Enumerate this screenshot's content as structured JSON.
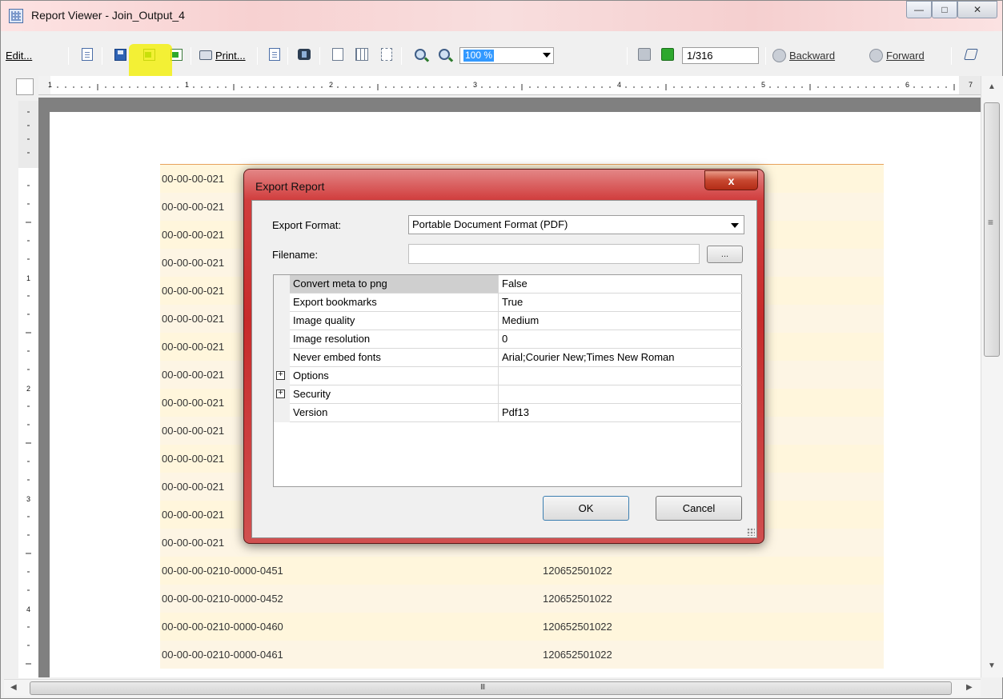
{
  "window": {
    "title": "Report Viewer - Join_Output_4",
    "controls": [
      "minimize",
      "maximize",
      "close"
    ]
  },
  "toolbar": {
    "edit_label": "Edit...",
    "print_label": "Print...",
    "zoom_value": "100 %",
    "page_value": "1/316",
    "backward_label": "Backward",
    "forward_label": "Forward",
    "icons": [
      "copy-icon",
      "save-icon",
      "export-icon",
      "export-page-icon",
      "print-icon",
      "copy-page-icon",
      "find-icon",
      "single-page-icon",
      "multi-page-icon",
      "continuous-icon",
      "zoom-out-icon",
      "zoom-in-icon",
      "prev-page-icon",
      "next-page-icon",
      "backward-icon",
      "forward-icon",
      "annotate-icon"
    ]
  },
  "ruler": {
    "horizontal_marks": [
      "1",
      "1",
      "2",
      "3",
      "4",
      "5",
      "6",
      "7"
    ],
    "vertical_marks": [
      "1",
      "2",
      "3",
      "4"
    ]
  },
  "report": {
    "rows": [
      {
        "id": "00-00-00-021",
        "value": ""
      },
      {
        "id": "00-00-00-021",
        "value": ""
      },
      {
        "id": "00-00-00-021",
        "value": ""
      },
      {
        "id": "00-00-00-021",
        "value": ""
      },
      {
        "id": "00-00-00-021",
        "value": ""
      },
      {
        "id": "00-00-00-021",
        "value": ""
      },
      {
        "id": "00-00-00-021",
        "value": ""
      },
      {
        "id": "00-00-00-021",
        "value": ""
      },
      {
        "id": "00-00-00-021",
        "value": ""
      },
      {
        "id": "00-00-00-021",
        "value": ""
      },
      {
        "id": "00-00-00-021",
        "value": ""
      },
      {
        "id": "00-00-00-021",
        "value": ""
      },
      {
        "id": "00-00-00-021",
        "value": ""
      },
      {
        "id": "00-00-00-021",
        "value": ""
      },
      {
        "id": "00-00-00-0210-0000-0451",
        "value": "120652501022"
      },
      {
        "id": "00-00-00-0210-0000-0452",
        "value": "120652501022"
      },
      {
        "id": "00-00-00-0210-0000-0460",
        "value": "120652501022"
      },
      {
        "id": "00-00-00-0210-0000-0461",
        "value": "120652501022"
      }
    ]
  },
  "dialog": {
    "title": "Export Report",
    "close_glyph": "x",
    "export_format_label": "Export Format:",
    "export_format_value": "Portable Document Format (PDF)",
    "filename_label": "Filename:",
    "filename_value": "",
    "browse_label": "...",
    "properties": [
      {
        "name": "Convert meta to png",
        "value": "False",
        "expandable": false
      },
      {
        "name": "Export bookmarks",
        "value": "True",
        "expandable": false
      },
      {
        "name": "Image quality",
        "value": "Medium",
        "expandable": false
      },
      {
        "name": "Image resolution",
        "value": "0",
        "expandable": false
      },
      {
        "name": "Never embed fonts",
        "value": "Arial;Courier New;Times New Roman",
        "expandable": false
      },
      {
        "name": "Options",
        "value": "",
        "expandable": true
      },
      {
        "name": "Security",
        "value": "",
        "expandable": true
      },
      {
        "name": "Version",
        "value": "Pdf13",
        "expandable": false
      }
    ],
    "ok_label": "OK",
    "cancel_label": "Cancel"
  },
  "highlight_color": "#f3f000",
  "accent_colors": {
    "dialog_frame": "#c72b2b",
    "row_band": "#fff6dc",
    "selection": "#3399ff"
  }
}
